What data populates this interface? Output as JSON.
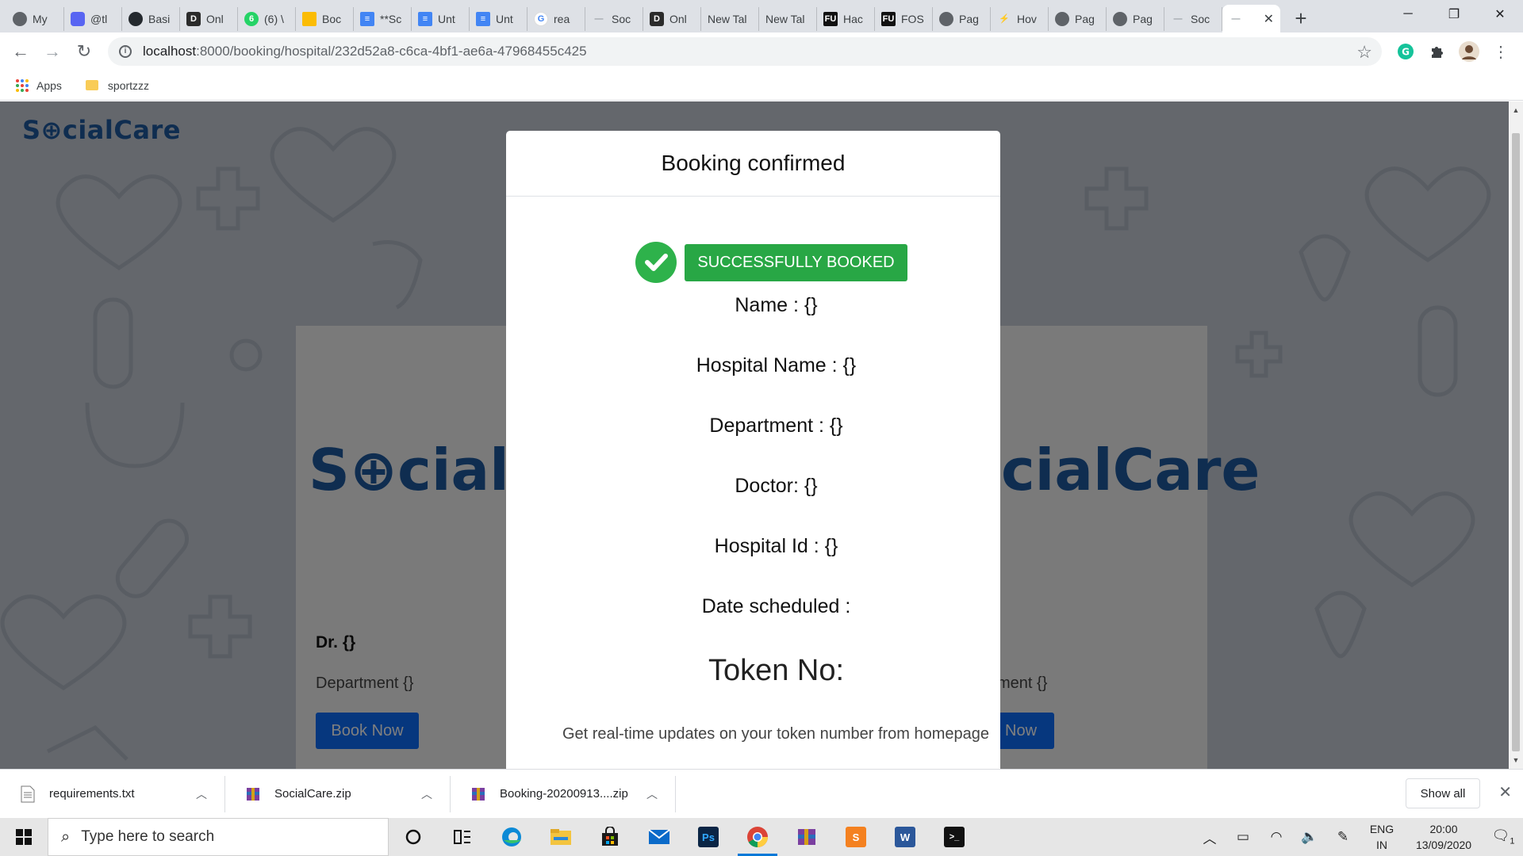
{
  "browser": {
    "tabs": [
      {
        "label": "My",
        "icon_color": "#5f6368"
      },
      {
        "label": "@tl",
        "icon_color": "#5865f2"
      },
      {
        "label": "Basi",
        "icon_color": "#24292e"
      },
      {
        "label": "Onl",
        "icon_color": "#2b2b2b"
      },
      {
        "label": "(6) \\",
        "icon_color": "#25d366"
      },
      {
        "label": "Boc",
        "icon_color": "#fbbc04"
      },
      {
        "label": "**Sc",
        "icon_color": "#4285f4"
      },
      {
        "label": "Unt",
        "icon_color": "#4285f4"
      },
      {
        "label": "Unt",
        "icon_color": "#4285f4"
      },
      {
        "label": "rea",
        "icon_color": "#ea4335"
      },
      {
        "label": "Soc",
        "icon_color": "#9aa0a6"
      },
      {
        "label": "Onl",
        "icon_color": "#2b2b2b"
      },
      {
        "label": "New Tal",
        "icon_color": ""
      },
      {
        "label": "New Tal",
        "icon_color": ""
      },
      {
        "label": "Hac",
        "icon_color": "#111111"
      },
      {
        "label": "FOS",
        "icon_color": "#111111"
      },
      {
        "label": "Pag",
        "icon_color": "#5f6368"
      },
      {
        "label": "Hov",
        "icon_color": "#f4b400"
      },
      {
        "label": "Pag",
        "icon_color": "#5f6368"
      },
      {
        "label": "Pag",
        "icon_color": "#5f6368"
      },
      {
        "label": "Soc",
        "icon_color": "#9aa0a6"
      }
    ],
    "url_host": "localhost",
    "url_path": ":8000/booking/hospital/232d52a8-c6ca-4bf1-ae6a-47968455c425",
    "bookmarks": [
      {
        "label": "Apps"
      },
      {
        "label": "sportzzz"
      }
    ]
  },
  "page": {
    "logo_text": "S⊕cialCare",
    "card_left": {
      "logo": "S⊕cialCa",
      "doctor": "Dr. {}",
      "department": "Department {}",
      "button": "Book Now"
    },
    "card_right": {
      "logo": "cialCare",
      "department": "ment {}",
      "button": "Now"
    }
  },
  "modal": {
    "title": "Booking confirmed",
    "status_badge": "SUCCESSFULLY BOOKED",
    "fields": [
      "Name : {}",
      "Hospital Name : {}",
      "Department : {}",
      "Doctor: {}",
      "Hospital Id : {}",
      "Date scheduled :"
    ],
    "token_label": "Token No:",
    "updates_text": "Get real-time updates on your token number from homepage"
  },
  "downloads": {
    "items": [
      {
        "name": "requirements.txt"
      },
      {
        "name": "SocialCare.zip"
      },
      {
        "name": "Booking-20200913....zip"
      }
    ],
    "show_all": "Show all"
  },
  "taskbar": {
    "search_placeholder": "Type here to search",
    "language_line1": "ENG",
    "language_line2": "IN",
    "time": "20:00",
    "date": "13/09/2020",
    "notification_count": "1"
  },
  "colors": {
    "brand_blue": "#1e5aa0",
    "success_green": "#28a745",
    "primary_button": "#0d6efd"
  }
}
